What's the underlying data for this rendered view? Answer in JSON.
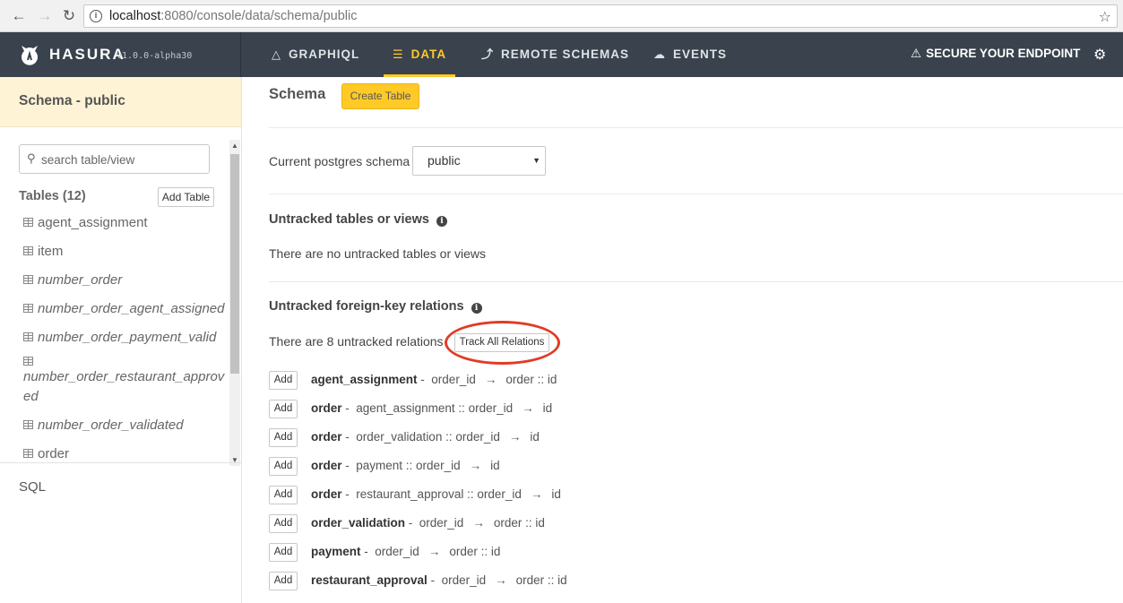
{
  "browser": {
    "url_host": "localhost",
    "url_rest": ":8080/console/data/schema/public"
  },
  "topnav": {
    "brand": "HASURA",
    "version": "v1.0.0-alpha30",
    "items": [
      {
        "label": "GRAPHIQL",
        "icon": "flask-icon"
      },
      {
        "label": "DATA",
        "icon": "database-icon",
        "active": true
      },
      {
        "label": "REMOTE SCHEMAS",
        "icon": "plug-icon"
      },
      {
        "label": "EVENTS",
        "icon": "cloud-icon"
      }
    ],
    "secure": "SECURE YOUR ENDPOINT",
    "accent_color": "#ffca27"
  },
  "sidebar": {
    "header": "Schema - public",
    "search_placeholder": "search table/view",
    "tables_title": "Tables (12)",
    "add_table": "Add Table",
    "tables": [
      {
        "name": "agent_assignment",
        "view": false
      },
      {
        "name": "item",
        "view": false
      },
      {
        "name": "number_order",
        "view": true
      },
      {
        "name": "number_order_agent_assigned",
        "view": true
      },
      {
        "name": "number_order_payment_valid",
        "view": true
      },
      {
        "name": "number_order_restaurant_approved",
        "view": true
      },
      {
        "name": "number_order_validated",
        "view": true
      },
      {
        "name": "order",
        "view": false
      }
    ],
    "sql": "SQL"
  },
  "main": {
    "title": "Schema",
    "create_table": "Create Table",
    "schema_label": "Current postgres schema",
    "schema_value": "public",
    "untracked_title": "Untracked tables or views",
    "untracked_text": "There are no untracked tables or views",
    "fk_title": "Untracked foreign-key relations",
    "fk_text": "There are 8 untracked relations",
    "track_all": "Track All Relations",
    "add_label": "Add",
    "relations": [
      {
        "table": "agent_assignment",
        "from": "order_id",
        "to": "order :: id"
      },
      {
        "table": "order",
        "from": "agent_assignment :: order_id",
        "to": "id"
      },
      {
        "table": "order",
        "from": "order_validation :: order_id",
        "to": "id"
      },
      {
        "table": "order",
        "from": "payment :: order_id",
        "to": "id"
      },
      {
        "table": "order",
        "from": "restaurant_approval :: order_id",
        "to": "id"
      },
      {
        "table": "order_validation",
        "from": "order_id",
        "to": "order :: id"
      },
      {
        "table": "payment",
        "from": "order_id",
        "to": "order :: id"
      },
      {
        "table": "restaurant_approval",
        "from": "order_id",
        "to": "order :: id"
      }
    ]
  }
}
